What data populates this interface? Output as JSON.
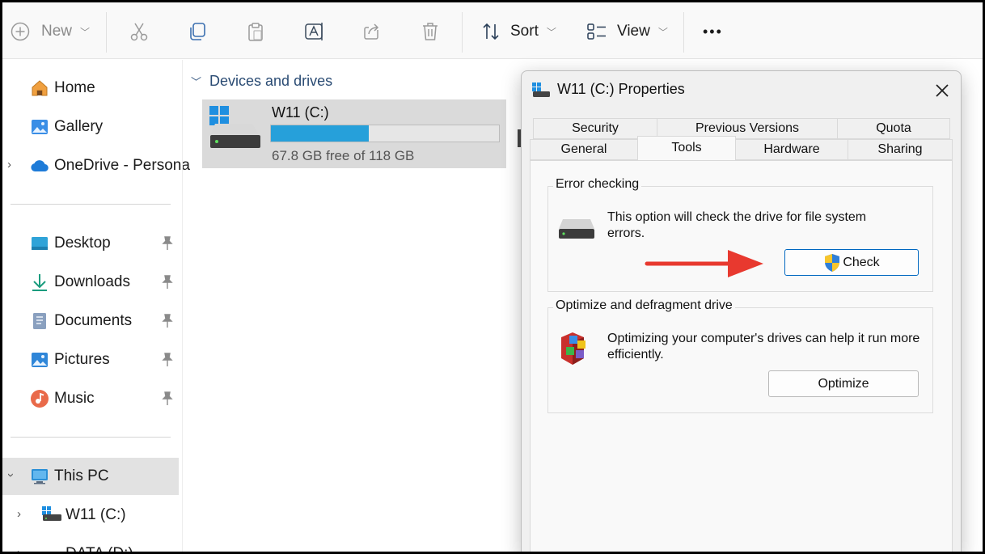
{
  "toolbar": {
    "new_label": "New",
    "sort_label": "Sort",
    "view_label": "View",
    "more_label": "•••"
  },
  "nav": {
    "home": "Home",
    "gallery": "Gallery",
    "onedrive": "OneDrive - Persona",
    "desktop": "Desktop",
    "downloads": "Downloads",
    "documents": "Documents",
    "pictures": "Pictures",
    "music": "Music",
    "this_pc": "This PC",
    "w11": "W11 (C:)",
    "data": "DATA (D:)"
  },
  "content": {
    "group_title": "Devices and drives",
    "drive": {
      "name": "W11 (C:)",
      "free_text": "67.8 GB free of 118 GB",
      "used_fraction": 0.43
    }
  },
  "dialog": {
    "title": "W11 (C:) Properties",
    "tabs_row1": [
      "Security",
      "Previous Versions",
      "Quota"
    ],
    "tabs_row2": [
      "General",
      "Tools",
      "Hardware",
      "Sharing"
    ],
    "active_tab": "Tools",
    "error_checking": {
      "title": "Error checking",
      "text": "This option will check the drive for file system errors.",
      "button": "Check"
    },
    "optimize": {
      "title": "Optimize and defragment drive",
      "text": "Optimizing your computer's drives can help it run more efficiently.",
      "button": "Optimize"
    }
  },
  "colors": {
    "accent": "#0067c0",
    "drive_bar": "#26a0da",
    "annotation_arrow": "#e8392f"
  }
}
